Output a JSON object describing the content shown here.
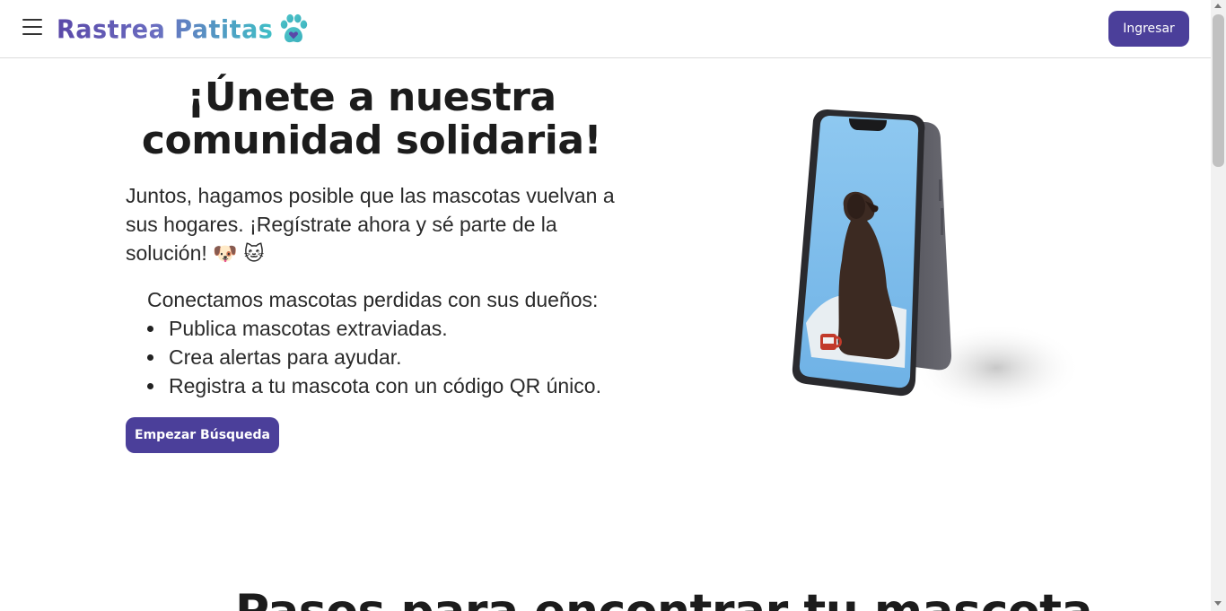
{
  "header": {
    "logo_text": "Rastrea Patitas",
    "login_label": "Ingresar"
  },
  "hero": {
    "title": "¡Únete a nuestra comunidad solidaria!",
    "description": "Juntos, hagamos posible que las mascotas vuelvan a sus hogares. ¡Regístrate ahora y sé parte de la solución!",
    "emojis": "🐶 🐱",
    "features_intro": "Conectamos mascotas perdidas con sus dueños:",
    "features": [
      "Publica mascotas extraviadas.",
      "Crea alertas para ayudar.",
      "Registra a tu mascota con un código QR único."
    ],
    "cta_label": "Empezar Búsqueda"
  },
  "next_section": {
    "title": "Pasos para encontrar tu mascota"
  },
  "colors": {
    "primary": "#4b3f9a",
    "logo_gradient_start": "#5a48a8",
    "logo_gradient_end": "#3fbfc6"
  },
  "icons": {
    "menu": "hamburger-icon",
    "logo": "paw-heart-icon"
  }
}
